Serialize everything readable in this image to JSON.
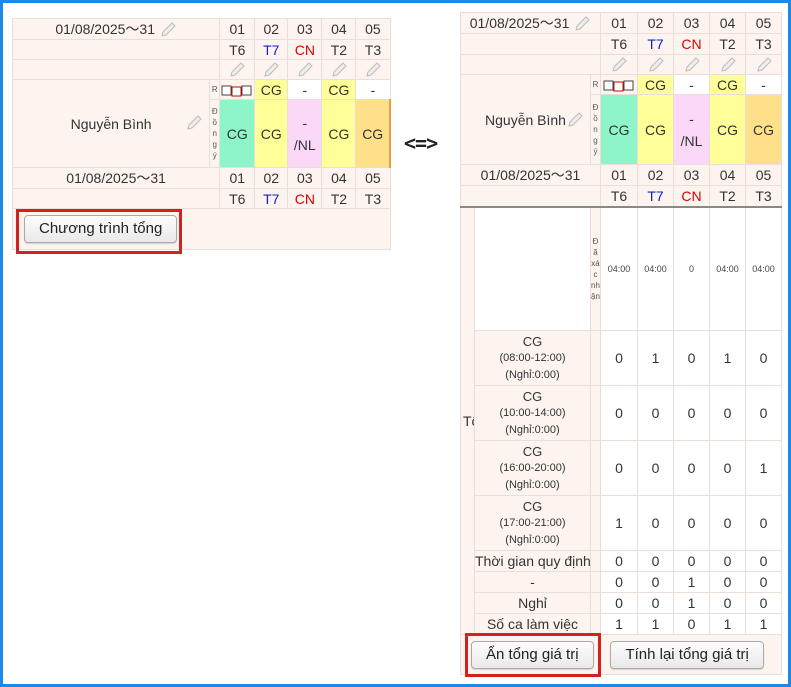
{
  "left": {
    "date_range": "01/08/2025～31",
    "days": [
      "01",
      "02",
      "03",
      "04",
      "05"
    ],
    "weekdays": [
      "T6",
      "T7",
      "CN",
      "T2",
      "T3"
    ],
    "employee": "Nguyễn Bình",
    "status_label_r": "R",
    "status_label_v": "Đồng ý",
    "top_row": [
      "CG",
      "-",
      "CG",
      "-"
    ],
    "shifts": [
      "CG",
      "CG",
      "-\n/NL",
      "CG",
      "CG"
    ],
    "button": "Chương trình tổng"
  },
  "arrow": "<=>",
  "right": {
    "date_range": "01/08/2025～31",
    "days": [
      "01",
      "02",
      "03",
      "04",
      "05"
    ],
    "weekdays": [
      "T6",
      "T7",
      "CN",
      "T2",
      "T3"
    ],
    "employee": "Nguyễn Bình",
    "status_label_r": "R",
    "status_label_v": "Đồng ý",
    "top_row": [
      "CG",
      "-",
      "CG",
      "-"
    ],
    "shifts": [
      "CG",
      "CG",
      "-\n/NL",
      "CG",
      "CG"
    ],
    "total_label": "Tổng",
    "confirmed_label": "Đã xác nhận",
    "confirmed_values": [
      "04:00",
      "04:00",
      "0",
      "04:00",
      "04:00"
    ],
    "shift_rows": [
      {
        "name": "CG",
        "time": "(08:00-12:00)",
        "rest": "(Nghỉ:0:00)",
        "values": [
          "0",
          "1",
          "0",
          "1",
          "0"
        ]
      },
      {
        "name": "CG",
        "time": "(10:00-14:00)",
        "rest": "(Nghỉ:0:00)",
        "values": [
          "0",
          "0",
          "0",
          "0",
          "0"
        ]
      },
      {
        "name": "CG",
        "time": "(16:00-20:00)",
        "rest": "(Nghỉ:0:00)",
        "values": [
          "0",
          "0",
          "0",
          "0",
          "1"
        ]
      },
      {
        "name": "CG",
        "time": "(17:00-21:00)",
        "rest": "(Nghỉ:0:00)",
        "values": [
          "1",
          "0",
          "0",
          "0",
          "0"
        ]
      }
    ],
    "summary_rows": [
      {
        "label": "Thời gian quy định",
        "values": [
          "0",
          "0",
          "0",
          "0",
          "0"
        ]
      },
      {
        "label": "-",
        "values": [
          "0",
          "0",
          "1",
          "0",
          "0"
        ]
      },
      {
        "label": "Nghỉ",
        "values": [
          "0",
          "0",
          "1",
          "0",
          "0"
        ]
      },
      {
        "label": "Số ca làm việc",
        "values": [
          "1",
          "1",
          "0",
          "1",
          "1"
        ]
      }
    ],
    "button_hide": "Ẩn tổng giá trị",
    "button_recalc": "Tính lại tổng giá trị"
  },
  "colors": {
    "frame": "#1e88e5",
    "highlight": "#d32020",
    "sunday": "#e00000",
    "saturday": "#1122cc"
  }
}
